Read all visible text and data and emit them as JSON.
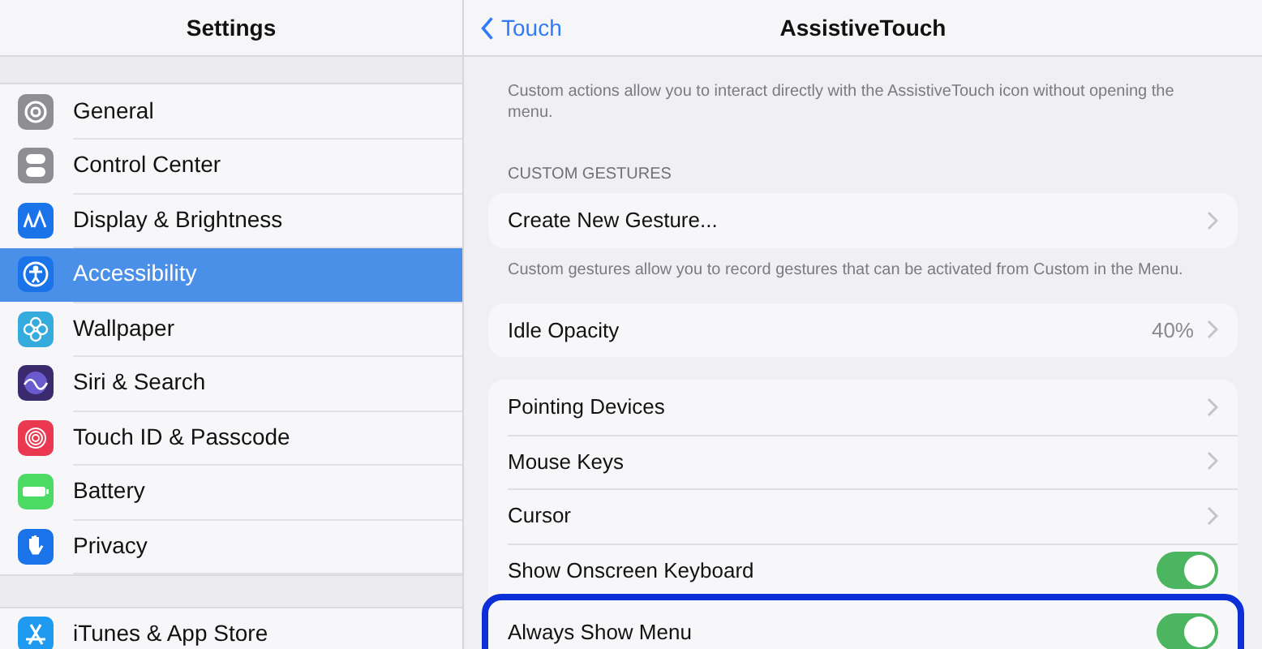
{
  "sidebar": {
    "title": "Settings",
    "groups": [
      {
        "items": [
          {
            "label": "General",
            "color": "#8e8e93",
            "selected": false
          },
          {
            "label": "Control Center",
            "color": "#8e8e93",
            "selected": false
          },
          {
            "label": "Display & Brightness",
            "color": "#1a73e8",
            "selected": false
          },
          {
            "label": "Accessibility",
            "color": "#1a73e8",
            "selected": true
          },
          {
            "label": "Wallpaper",
            "color": "#35aadc",
            "selected": false
          },
          {
            "label": "Siri & Search",
            "color": "#3b2a6e",
            "selected": false
          },
          {
            "label": "Touch ID & Passcode",
            "color": "#e9384f",
            "selected": false
          },
          {
            "label": "Battery",
            "color": "#4cd964",
            "selected": false
          },
          {
            "label": "Privacy",
            "color": "#1a73e8",
            "selected": false
          }
        ]
      },
      {
        "items": [
          {
            "label": "iTunes & App Store",
            "color": "#1e9bf0",
            "selected": false
          }
        ]
      }
    ]
  },
  "detail": {
    "back": "Touch",
    "title": "AssistiveTouch",
    "sections": [
      {
        "footer": "Custom actions allow you to interact directly with the AssistiveTouch icon without opening the menu."
      },
      {
        "header": "CUSTOM GESTURES",
        "rows": [
          {
            "label": "Create New Gesture...",
            "kind": "link"
          }
        ],
        "footer": "Custom gestures allow you to record gestures that can be activated from Custom in the Menu."
      },
      {
        "rows": [
          {
            "label": "Idle Opacity",
            "kind": "value",
            "value": "40%"
          }
        ]
      },
      {
        "rows": [
          {
            "label": "Pointing Devices",
            "kind": "link"
          },
          {
            "label": "Mouse Keys",
            "kind": "link"
          },
          {
            "label": "Cursor",
            "kind": "link"
          },
          {
            "label": "Show Onscreen Keyboard",
            "kind": "toggle",
            "on": true,
            "highlighted": false
          },
          {
            "label": "Always Show Menu",
            "kind": "toggle",
            "on": true,
            "highlighted": true
          }
        ]
      }
    ]
  }
}
